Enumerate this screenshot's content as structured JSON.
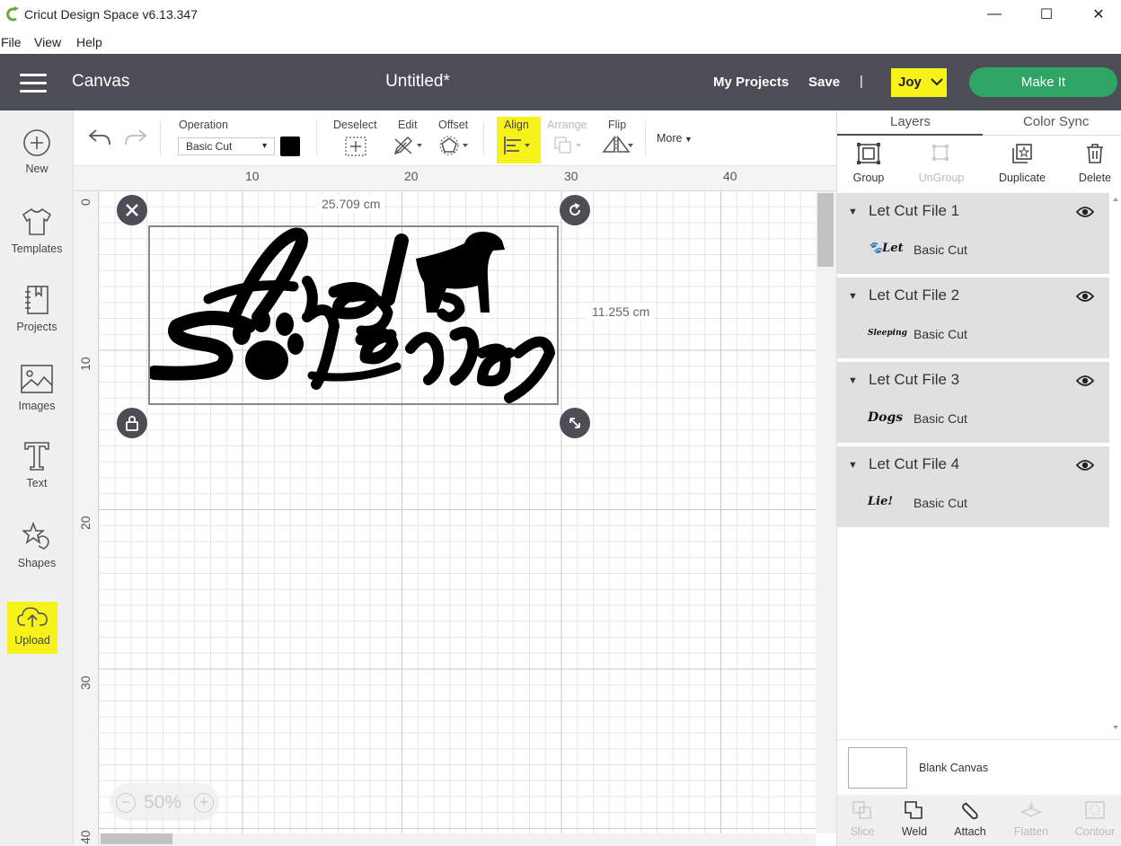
{
  "window": {
    "title": "Cricut Design Space  v6.13.347",
    "minimize": "—",
    "maximize": "☐",
    "close": "✕"
  },
  "menubar": [
    "File",
    "View",
    "Help"
  ],
  "header": {
    "canvas_label": "Canvas",
    "doc_title": "Untitled*",
    "my_projects": "My Projects",
    "save": "Save",
    "separator": "|",
    "user": "Joy",
    "make_it": "Make It"
  },
  "sidebar": [
    {
      "label": "New",
      "icon": "plus-circle-icon"
    },
    {
      "label": "Templates",
      "icon": "tshirt-icon"
    },
    {
      "label": "Projects",
      "icon": "notebook-icon"
    },
    {
      "label": "Images",
      "icon": "image-icon"
    },
    {
      "label": "Text",
      "icon": "text-t-icon"
    },
    {
      "label": "Shapes",
      "icon": "shapes-icon"
    },
    {
      "label": "Upload",
      "icon": "cloud-upload-icon"
    }
  ],
  "toolbar": {
    "operation_label": "Operation",
    "operation_value": "Basic Cut",
    "deselect": "Deselect",
    "edit": "Edit",
    "offset": "Offset",
    "align": "Align",
    "arrange": "Arrange",
    "flip": "Flip",
    "more": "More"
  },
  "rulers": {
    "top": [
      "10",
      "20",
      "30",
      "40"
    ],
    "left": [
      "0",
      "10",
      "20",
      "30",
      "40"
    ]
  },
  "selection": {
    "width_label": "25.709 cm",
    "height_label": "11.255 cm"
  },
  "zoom": {
    "value": "50%",
    "minus": "−",
    "plus": "+"
  },
  "panel": {
    "tabs": [
      "Layers",
      "Color Sync"
    ],
    "actions": [
      {
        "label": "Group",
        "enabled": true,
        "icon": "group-icon"
      },
      {
        "label": "UnGroup",
        "enabled": false,
        "icon": "ungroup-icon"
      },
      {
        "label": "Duplicate",
        "enabled": true,
        "icon": "duplicate-icon"
      },
      {
        "label": "Delete",
        "enabled": true,
        "icon": "trash-icon"
      }
    ],
    "layers": [
      {
        "name": "Let Cut File 1",
        "thumb": "🐾Let",
        "operation": "Basic Cut"
      },
      {
        "name": "Let Cut File 2",
        "thumb": "Sleeping",
        "operation": "Basic Cut"
      },
      {
        "name": "Let Cut File 3",
        "thumb": "Dogs",
        "operation": "Basic Cut"
      },
      {
        "name": "Let Cut File 4",
        "thumb": "Lie!",
        "operation": "Basic Cut"
      }
    ],
    "blank_canvas": "Blank Canvas",
    "bottom_actions": [
      {
        "label": "Slice",
        "enabled": false
      },
      {
        "label": "Weld",
        "enabled": true
      },
      {
        "label": "Attach",
        "enabled": true
      },
      {
        "label": "Flatten",
        "enabled": false
      },
      {
        "label": "Contour",
        "enabled": false
      }
    ]
  },
  "colors": {
    "header_bg": "#4b4f55",
    "make_it": "#2ea565",
    "highlight": "#f7f21a",
    "layer_bg": "#e0e0e0"
  }
}
